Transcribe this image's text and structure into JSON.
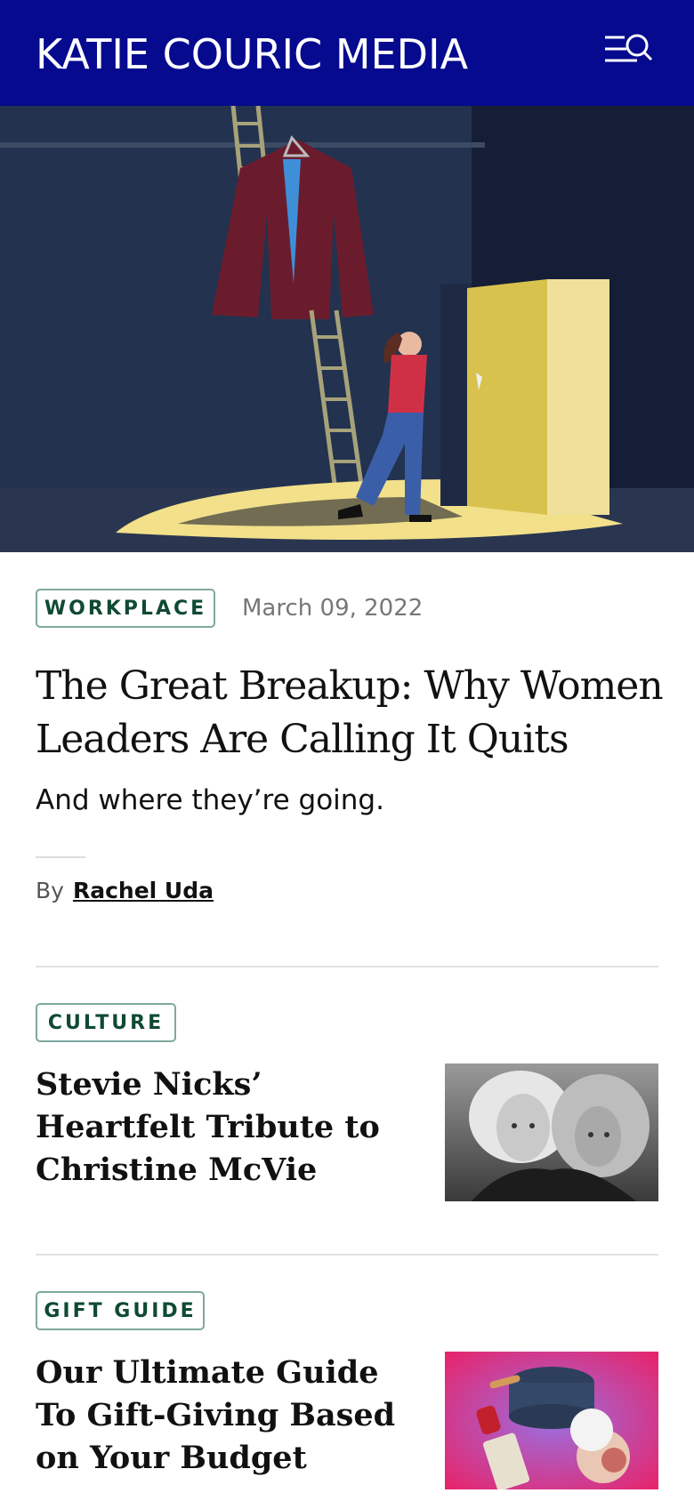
{
  "header": {
    "logo": "KATIE COURIC MEDIA",
    "menu_icon": "menu-search-icon",
    "background": "#050a8f"
  },
  "hero": {
    "image": "illustration-woman-leaving-through-door-icon"
  },
  "article": {
    "category": "WORKPLACE",
    "date": "March 09, 2022",
    "headline": "The Great Breakup: Why Women Leaders Are Calling It Quits",
    "dek": "And where they’re going.",
    "byline_prefix": "By",
    "author": "Rachel Uda"
  },
  "cards": [
    {
      "category": "CULTURE",
      "title": "Stevie Nicks’ Heartfelt Tribute to Christine McVie",
      "image": "two-women-portrait-bw-icon"
    },
    {
      "category": "GIFT GUIDE",
      "title": "Our Ultimate Guide To Gift-Giving Based on Your Budget",
      "image": "gift-products-collage-icon"
    }
  ],
  "colors": {
    "tag_text": "#0f4a32",
    "tag_border": "#7ea89f"
  }
}
